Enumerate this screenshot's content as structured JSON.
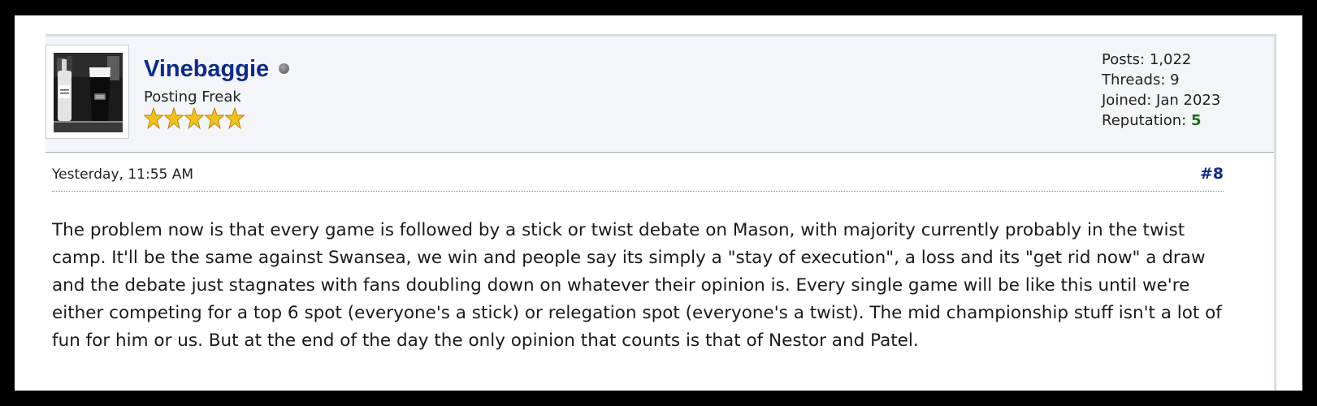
{
  "author": {
    "username": "Vinebaggie",
    "status": "offline",
    "title": "Posting Freak",
    "star_count": 5,
    "avatar_icon": "avatar-photo",
    "stats": {
      "posts_label": "Posts:",
      "posts_value": "1,022",
      "threads_label": "Threads:",
      "threads_value": "9",
      "joined_label": "Joined:",
      "joined_value": "Jan 2023",
      "reputation_label": "Reputation:",
      "reputation_value": "5"
    }
  },
  "post": {
    "date": "Yesterday, 11:55 AM",
    "number": "#8",
    "body": "The problem now is that every game is followed by a stick or twist debate on Mason, with majority currently probably in the twist camp. It'll be the same against Swansea, we win and people say its simply a \"stay of execution\", a loss and its \"get rid now\" a draw and the debate just stagnates with fans doubling down on whatever their opinion is. Every single game will be like this until we're either competing for a top 6 spot (everyone's a stick) or relegation spot (everyone's a twist). The mid championship stuff isn't a lot of fun for him or us. But at the end of the day the only opinion that counts is that of Nestor and Patel."
  },
  "colors": {
    "username": "#0f2a8c",
    "reputation_value": "#1e6e12",
    "author_bar_bg": "#f4f5f9",
    "star_fill": "#f3c21a"
  }
}
